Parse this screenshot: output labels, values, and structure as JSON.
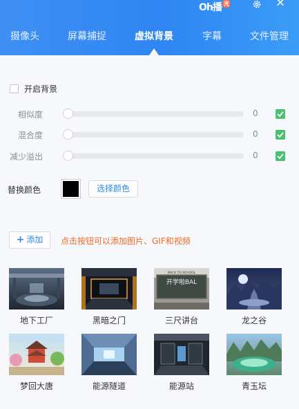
{
  "header": {
    "logo_text": "Oh播",
    "logo_badge": "光",
    "tabs": [
      {
        "label": "摄像头",
        "active": false
      },
      {
        "label": "屏幕捕捉",
        "active": false
      },
      {
        "label": "虚拟背景",
        "active": true
      },
      {
        "label": "字幕",
        "active": false
      },
      {
        "label": "文件管理",
        "active": false
      }
    ]
  },
  "settings": {
    "enable_bg_label": "开启背景",
    "sliders": [
      {
        "label": "相似度",
        "value": "0"
      },
      {
        "label": "混合度",
        "value": "0"
      },
      {
        "label": "减少溢出",
        "value": "0"
      }
    ],
    "replace_color_label": "替换颜色",
    "replace_color": "#000000",
    "choose_color_label": "选择颜色"
  },
  "add": {
    "button_label": "添加",
    "hint": "点击按钮可以添加图片、GIF和视频"
  },
  "backgrounds": [
    {
      "name": "地下工厂"
    },
    {
      "name": "黑暗之门"
    },
    {
      "name": "三尺讲台",
      "sign_text": "BACK TO SCHOOL",
      "board_text": "开学啦BAL"
    },
    {
      "name": "龙之谷"
    },
    {
      "name": "梦回大唐"
    },
    {
      "name": "能源隧道"
    },
    {
      "name": "能源站"
    },
    {
      "name": "青玉坛"
    }
  ],
  "colors": {
    "header_blue": "#2f86f2",
    "accent_blue": "#2e8ae6",
    "check_green": "#49c16e",
    "hint_orange": "#f06a23"
  }
}
